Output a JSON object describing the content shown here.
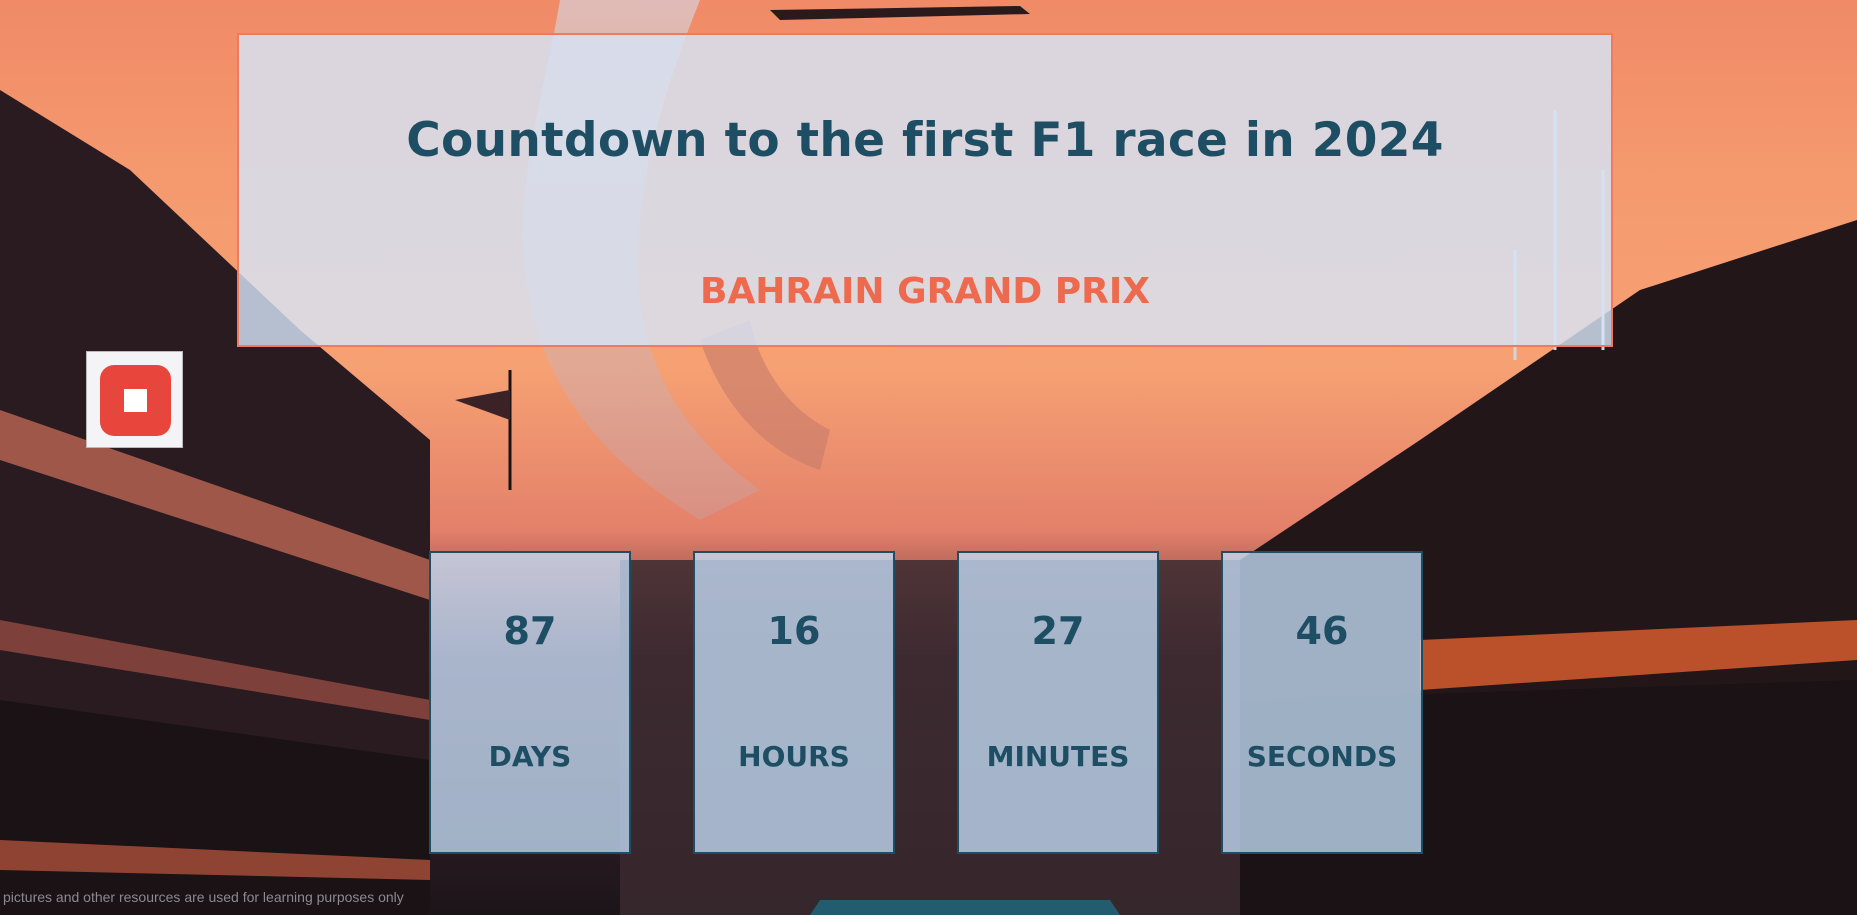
{
  "header": {
    "title": "Countdown to the first F1 race in 2024",
    "race_name": "BAHRAIN GRAND PRIX"
  },
  "controls": {
    "stop_icon": "stop-icon"
  },
  "countdown": [
    {
      "value": "87",
      "label": "DAYS"
    },
    {
      "value": "16",
      "label": "HOURS"
    },
    {
      "value": "27",
      "label": "MINUTES"
    },
    {
      "value": "46",
      "label": "SECONDS"
    }
  ],
  "footer": {
    "note": "l pictures and other resources are used for learning purposes only"
  },
  "colors": {
    "title": "#1e4e63",
    "race_name": "#ee6a4e",
    "stop_button": "#e8463d",
    "header_border": "#f07a60"
  }
}
